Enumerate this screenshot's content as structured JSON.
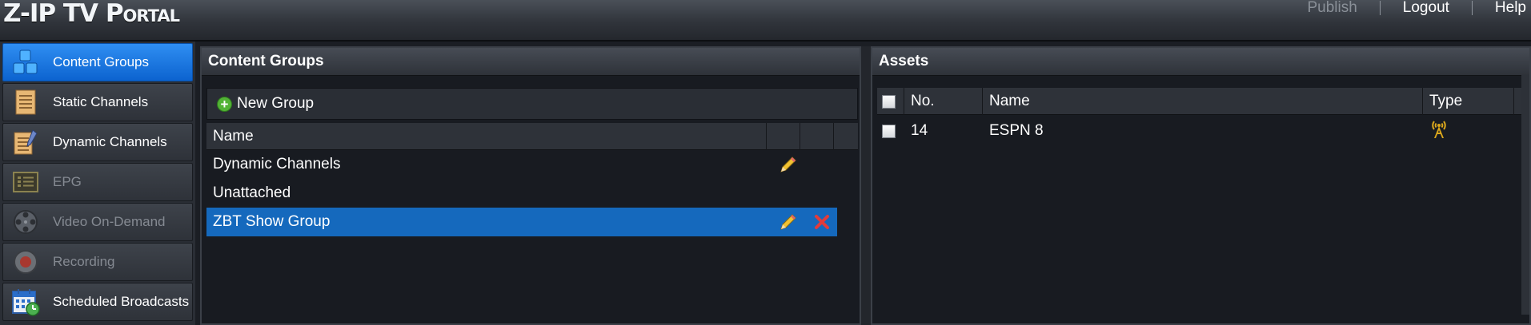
{
  "app": {
    "logo_big_1": "Z",
    "logo_dash": "-",
    "logo_big_2": "IP",
    "logo_big_3": " TV ",
    "logo_big_4": "P",
    "logo_small": "ORTAL"
  },
  "topnav": {
    "publish": "Publish",
    "logout": "Logout",
    "help": "Help"
  },
  "sidebar": {
    "items": [
      {
        "label": "Content Groups",
        "icon": "content-groups-icon",
        "active": true
      },
      {
        "label": "Static Channels",
        "icon": "static-channels-icon"
      },
      {
        "label": "Dynamic Channels",
        "icon": "dynamic-channels-icon"
      },
      {
        "label": "EPG",
        "icon": "epg-icon",
        "disabled": true
      },
      {
        "label": "Video On-Demand",
        "icon": "film-reel-icon",
        "disabled": true
      },
      {
        "label": "Recording",
        "icon": "record-icon",
        "disabled": true
      },
      {
        "label": "Scheduled Broadcasts",
        "icon": "calendar-clock-icon"
      }
    ]
  },
  "content_groups": {
    "title": "Content Groups",
    "new_group_label": "New Group",
    "column_name": "Name",
    "rows": [
      {
        "name": "Dynamic Channels",
        "editable": true,
        "deletable": false
      },
      {
        "name": "Unattached",
        "editable": false,
        "deletable": false
      },
      {
        "name": "ZBT Show Group",
        "editable": true,
        "deletable": true,
        "selected": true
      }
    ]
  },
  "assets": {
    "title": "Assets",
    "columns": [
      "No.",
      "Name",
      "Type"
    ],
    "rows": [
      {
        "no": "14",
        "name": "ESPN 8",
        "type_icon": "broadcast-antenna-icon"
      }
    ]
  },
  "colors": {
    "accent": "#1569bd",
    "active_nav": "#0c63cf",
    "add_green": "#52b336",
    "delete_red": "#e23b3b",
    "antenna_gold": "#d9a61c"
  }
}
